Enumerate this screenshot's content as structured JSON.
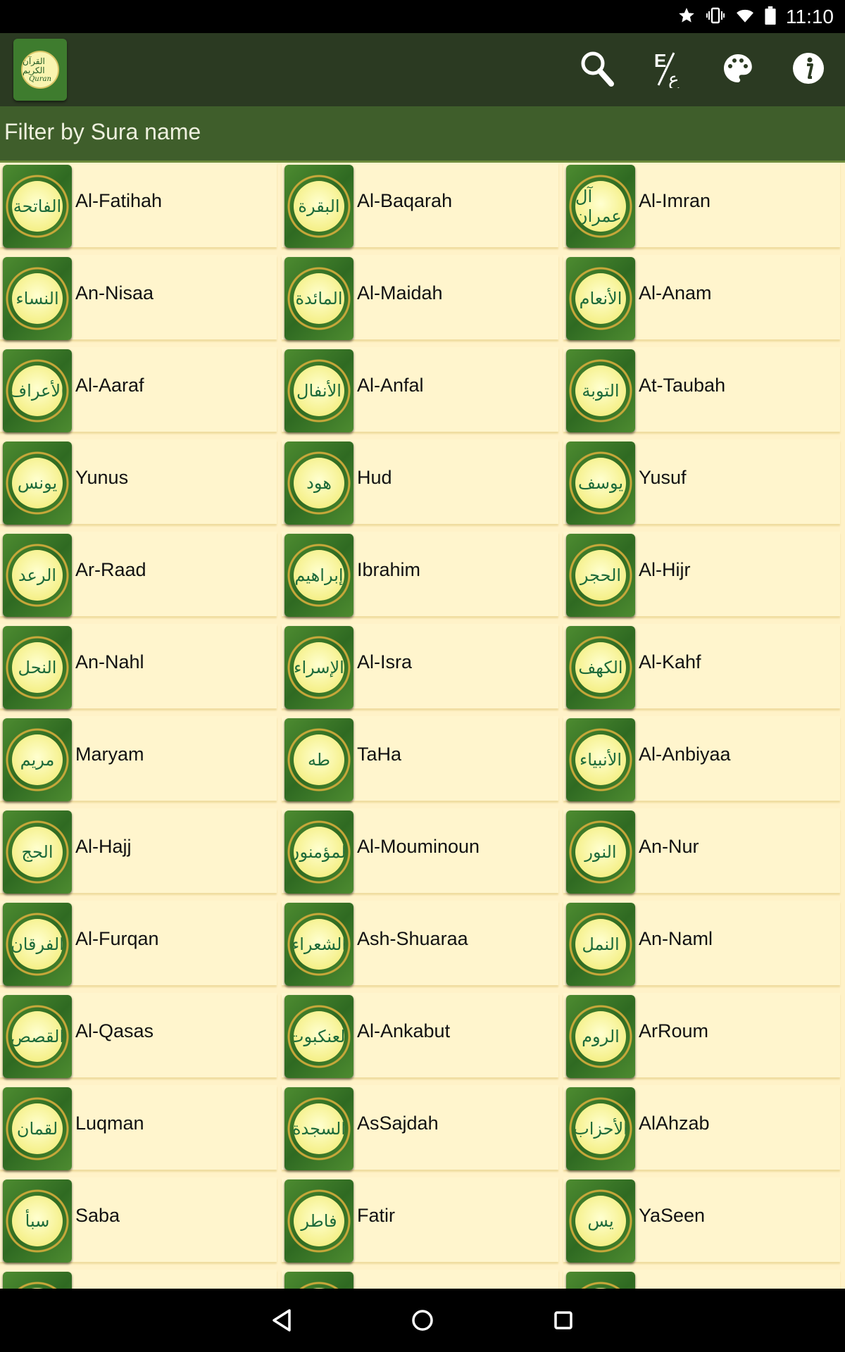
{
  "status_bar": {
    "time": "11:10",
    "icons": [
      "star-icon",
      "vibrate-icon",
      "wifi-icon",
      "battery-icon"
    ]
  },
  "app_bar": {
    "logo": {
      "arabic": "القرآن الكريم",
      "english": "Quran"
    },
    "actions": [
      "search-icon",
      "language-toggle-icon",
      "palette-icon",
      "info-icon"
    ],
    "language_toggle_glyphs": {
      "top": "E",
      "bottom": "ع"
    }
  },
  "filter": {
    "placeholder": "Filter by Sura name",
    "value": ""
  },
  "suras": [
    {
      "name": "Al-Fatihah",
      "arabic": "الفاتحة"
    },
    {
      "name": "Al-Baqarah",
      "arabic": "البقرة"
    },
    {
      "name": "Al-Imran",
      "arabic": "آل عمران"
    },
    {
      "name": "An-Nisaa",
      "arabic": "النساء"
    },
    {
      "name": "Al-Maidah",
      "arabic": "المائدة"
    },
    {
      "name": "Al-Anam",
      "arabic": "الأنعام"
    },
    {
      "name": "Al-Aaraf",
      "arabic": "الأعراف"
    },
    {
      "name": "Al-Anfal",
      "arabic": "الأنفال"
    },
    {
      "name": "At-Taubah",
      "arabic": "التوبة"
    },
    {
      "name": "Yunus",
      "arabic": "يونس"
    },
    {
      "name": "Hud",
      "arabic": "هود"
    },
    {
      "name": "Yusuf",
      "arabic": "يوسف"
    },
    {
      "name": "Ar-Raad",
      "arabic": "الرعد"
    },
    {
      "name": "Ibrahim",
      "arabic": "إبراهيم"
    },
    {
      "name": "Al-Hijr",
      "arabic": "الحجر"
    },
    {
      "name": "An-Nahl",
      "arabic": "النحل"
    },
    {
      "name": "Al-Isra",
      "arabic": "الإسراء"
    },
    {
      "name": "Al-Kahf",
      "arabic": "الكهف"
    },
    {
      "name": "Maryam",
      "arabic": "مريم"
    },
    {
      "name": "TaHa",
      "arabic": "طه"
    },
    {
      "name": "Al-Anbiyaa",
      "arabic": "الأنبياء"
    },
    {
      "name": "Al-Hajj",
      "arabic": "الحج"
    },
    {
      "name": "Al-Mouminoun",
      "arabic": "المؤمنون"
    },
    {
      "name": "An-Nur",
      "arabic": "النور"
    },
    {
      "name": "Al-Furqan",
      "arabic": "الفرقان"
    },
    {
      "name": "Ash-Shuaraa",
      "arabic": "الشعراء"
    },
    {
      "name": "An-Naml",
      "arabic": "النمل"
    },
    {
      "name": "Al-Qasas",
      "arabic": "القصص"
    },
    {
      "name": "Al-Ankabut",
      "arabic": "العنكبوت"
    },
    {
      "name": "ArRoum",
      "arabic": "الروم"
    },
    {
      "name": "Luqman",
      "arabic": "لقمان"
    },
    {
      "name": "AsSajdah",
      "arabic": "السجدة"
    },
    {
      "name": "AlAhzab",
      "arabic": "الأحزاب"
    },
    {
      "name": "Saba",
      "arabic": "سبأ"
    },
    {
      "name": "Fatir",
      "arabic": "فاطر"
    },
    {
      "name": "YaSeen",
      "arabic": "يس"
    },
    {
      "name": "",
      "arabic": ""
    },
    {
      "name": "",
      "arabic": ""
    },
    {
      "name": "",
      "arabic": ""
    }
  ],
  "nav_bar": {
    "buttons": [
      "back-icon",
      "home-icon",
      "recents-icon"
    ]
  },
  "colors": {
    "app_bar": "#2b3a22",
    "filter_bar": "#3f5e2b",
    "grid_background": "#fff2c8",
    "card_background": "#fff5cd",
    "badge_green": "#3e7c2e",
    "medallion_yellow": "#f5f08a",
    "text": "#111111"
  }
}
